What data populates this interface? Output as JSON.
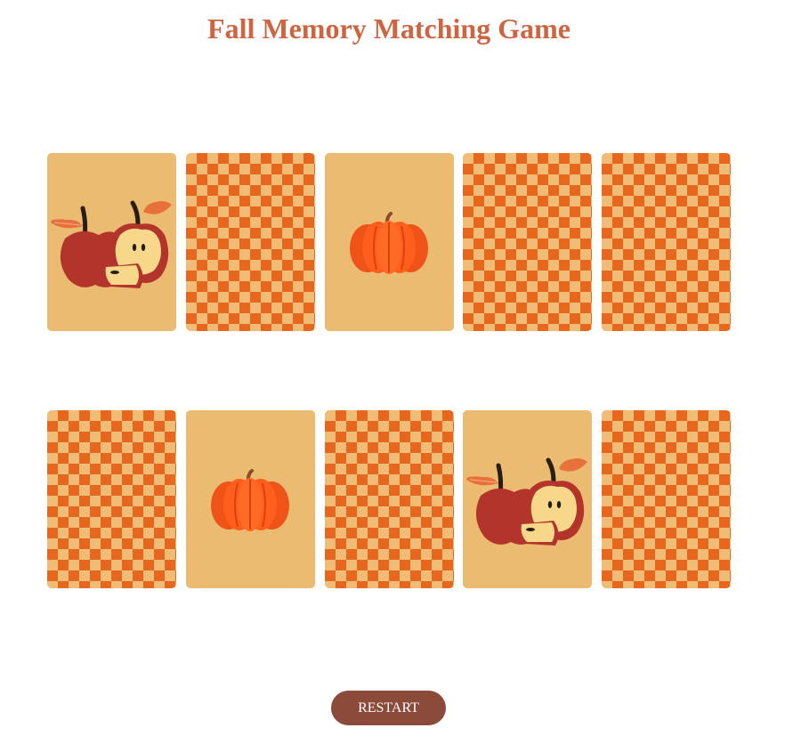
{
  "title": "Fall Memory Matching Game",
  "restart_label": "RESTART",
  "colors": {
    "title": "#cf6440",
    "card_face": "#ebbb72",
    "card_back_dark": "#e8671f",
    "card_back_light": "#f1bc75",
    "restart_button": "#8c4a3a"
  },
  "cards": [
    {
      "state": "face-up",
      "symbol": "apple-icon"
    },
    {
      "state": "face-down",
      "symbol": ""
    },
    {
      "state": "face-up",
      "symbol": "pumpkin-icon"
    },
    {
      "state": "face-down",
      "symbol": ""
    },
    {
      "state": "face-down",
      "symbol": ""
    },
    {
      "state": "face-down",
      "symbol": ""
    },
    {
      "state": "face-up",
      "symbol": "pumpkin-icon"
    },
    {
      "state": "face-down",
      "symbol": ""
    },
    {
      "state": "face-up",
      "symbol": "apple-icon"
    },
    {
      "state": "face-down",
      "symbol": ""
    }
  ]
}
